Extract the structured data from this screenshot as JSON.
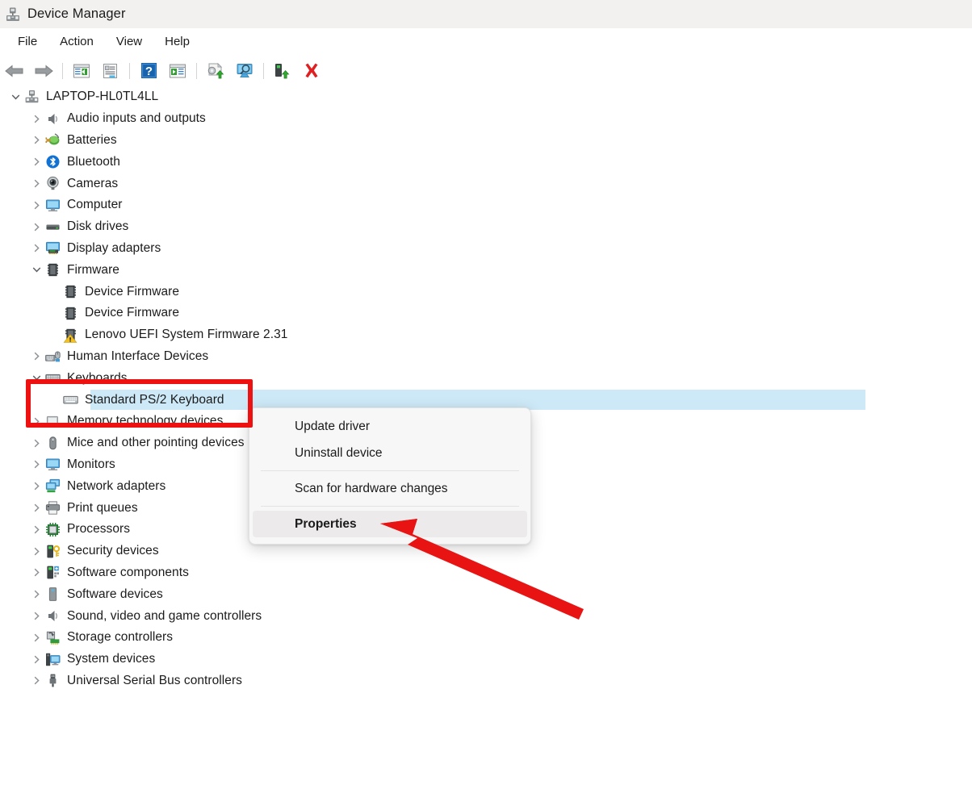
{
  "window": {
    "title": "Device Manager",
    "icon": "device-manager-icon"
  },
  "menubar": {
    "items": [
      {
        "label": "File",
        "name": "menu-file"
      },
      {
        "label": "Action",
        "name": "menu-action"
      },
      {
        "label": "View",
        "name": "menu-view"
      },
      {
        "label": "Help",
        "name": "menu-help"
      }
    ]
  },
  "toolbar": {
    "buttons": [
      {
        "icon": "back-arrow-icon",
        "name": "toolbar-back"
      },
      {
        "icon": "forward-arrow-icon",
        "name": "toolbar-forward"
      },
      {
        "icon": "show-hide-console-tree-icon",
        "name": "toolbar-console-tree"
      },
      {
        "icon": "properties-icon",
        "name": "toolbar-properties"
      },
      {
        "icon": "help-icon",
        "name": "toolbar-help"
      },
      {
        "icon": "show-hide-action-pane-icon",
        "name": "toolbar-action-pane"
      },
      {
        "icon": "update-driver-icon",
        "name": "toolbar-update-driver"
      },
      {
        "icon": "scan-hardware-changes-icon",
        "name": "toolbar-scan-hardware"
      },
      {
        "icon": "enable-device-icon",
        "name": "toolbar-enable-device"
      },
      {
        "icon": "uninstall-device-icon",
        "name": "toolbar-uninstall-device"
      }
    ]
  },
  "tree": {
    "root": {
      "label": "LAPTOP-HL0TL4LL",
      "icon": "computer-root-icon",
      "expanded": true
    },
    "nodes": [
      {
        "label": "Audio inputs and outputs",
        "icon": "speaker-icon",
        "depth": 1,
        "state": "collapsed"
      },
      {
        "label": "Batteries",
        "icon": "battery-icon",
        "depth": 1,
        "state": "collapsed"
      },
      {
        "label": "Bluetooth",
        "icon": "bluetooth-icon",
        "depth": 1,
        "state": "collapsed"
      },
      {
        "label": "Cameras",
        "icon": "camera-icon",
        "depth": 1,
        "state": "collapsed"
      },
      {
        "label": "Computer",
        "icon": "computer-icon",
        "depth": 1,
        "state": "collapsed"
      },
      {
        "label": "Disk drives",
        "icon": "disk-drive-icon",
        "depth": 1,
        "state": "collapsed"
      },
      {
        "label": "Display adapters",
        "icon": "display-adapter-icon",
        "depth": 1,
        "state": "collapsed"
      },
      {
        "label": "Firmware",
        "icon": "firmware-icon",
        "depth": 1,
        "state": "expanded"
      },
      {
        "label": "Device Firmware",
        "icon": "firmware-icon",
        "depth": 2,
        "state": "leaf"
      },
      {
        "label": "Device Firmware",
        "icon": "firmware-icon",
        "depth": 2,
        "state": "leaf"
      },
      {
        "label": "Lenovo UEFI System Firmware 2.31",
        "icon": "firmware-warning-icon",
        "depth": 2,
        "state": "leaf"
      },
      {
        "label": "Human Interface Devices",
        "icon": "hid-icon",
        "depth": 1,
        "state": "collapsed"
      },
      {
        "label": "Keyboards",
        "icon": "keyboard-icon",
        "depth": 1,
        "state": "expanded"
      },
      {
        "label": "Standard PS/2 Keyboard",
        "icon": "keyboard-icon",
        "depth": 2,
        "state": "leaf",
        "selected": true
      },
      {
        "label": "Memory technology devices",
        "icon": "memory-device-icon",
        "depth": 1,
        "state": "collapsed"
      },
      {
        "label": "Mice and other pointing devices",
        "icon": "mouse-icon",
        "depth": 1,
        "state": "collapsed"
      },
      {
        "label": "Monitors",
        "icon": "monitor-icon",
        "depth": 1,
        "state": "collapsed"
      },
      {
        "label": "Network adapters",
        "icon": "network-adapter-icon",
        "depth": 1,
        "state": "collapsed"
      },
      {
        "label": "Print queues",
        "icon": "printer-icon",
        "depth": 1,
        "state": "collapsed"
      },
      {
        "label": "Processors",
        "icon": "processor-icon",
        "depth": 1,
        "state": "collapsed"
      },
      {
        "label": "Security devices",
        "icon": "security-device-icon",
        "depth": 1,
        "state": "collapsed"
      },
      {
        "label": "Software components",
        "icon": "software-component-icon",
        "depth": 1,
        "state": "collapsed"
      },
      {
        "label": "Software devices",
        "icon": "software-device-icon",
        "depth": 1,
        "state": "collapsed"
      },
      {
        "label": "Sound, video and game controllers",
        "icon": "sound-controller-icon",
        "depth": 1,
        "state": "collapsed"
      },
      {
        "label": "Storage controllers",
        "icon": "storage-controller-icon",
        "depth": 1,
        "state": "collapsed"
      },
      {
        "label": "System devices",
        "icon": "system-device-icon",
        "depth": 1,
        "state": "collapsed"
      },
      {
        "label": "Universal Serial Bus controllers",
        "icon": "usb-controller-icon",
        "depth": 1,
        "state": "collapsed"
      }
    ]
  },
  "context_menu": {
    "items": [
      {
        "label": "Update driver",
        "name": "context-update-driver",
        "highlighted": false
      },
      {
        "label": "Uninstall device",
        "name": "context-uninstall-device",
        "highlighted": false
      },
      {
        "separator": true
      },
      {
        "label": "Scan for hardware changes",
        "name": "context-scan-hardware",
        "highlighted": false
      },
      {
        "separator": true
      },
      {
        "label": "Properties",
        "name": "context-properties",
        "highlighted": true
      }
    ]
  },
  "annotations": {
    "highlight_box": {
      "target": "keyboards-and-standard-ps2-keyboard",
      "color": "#ee1111"
    },
    "arrow": {
      "points_to": "Properties",
      "color": "#e81313"
    }
  }
}
